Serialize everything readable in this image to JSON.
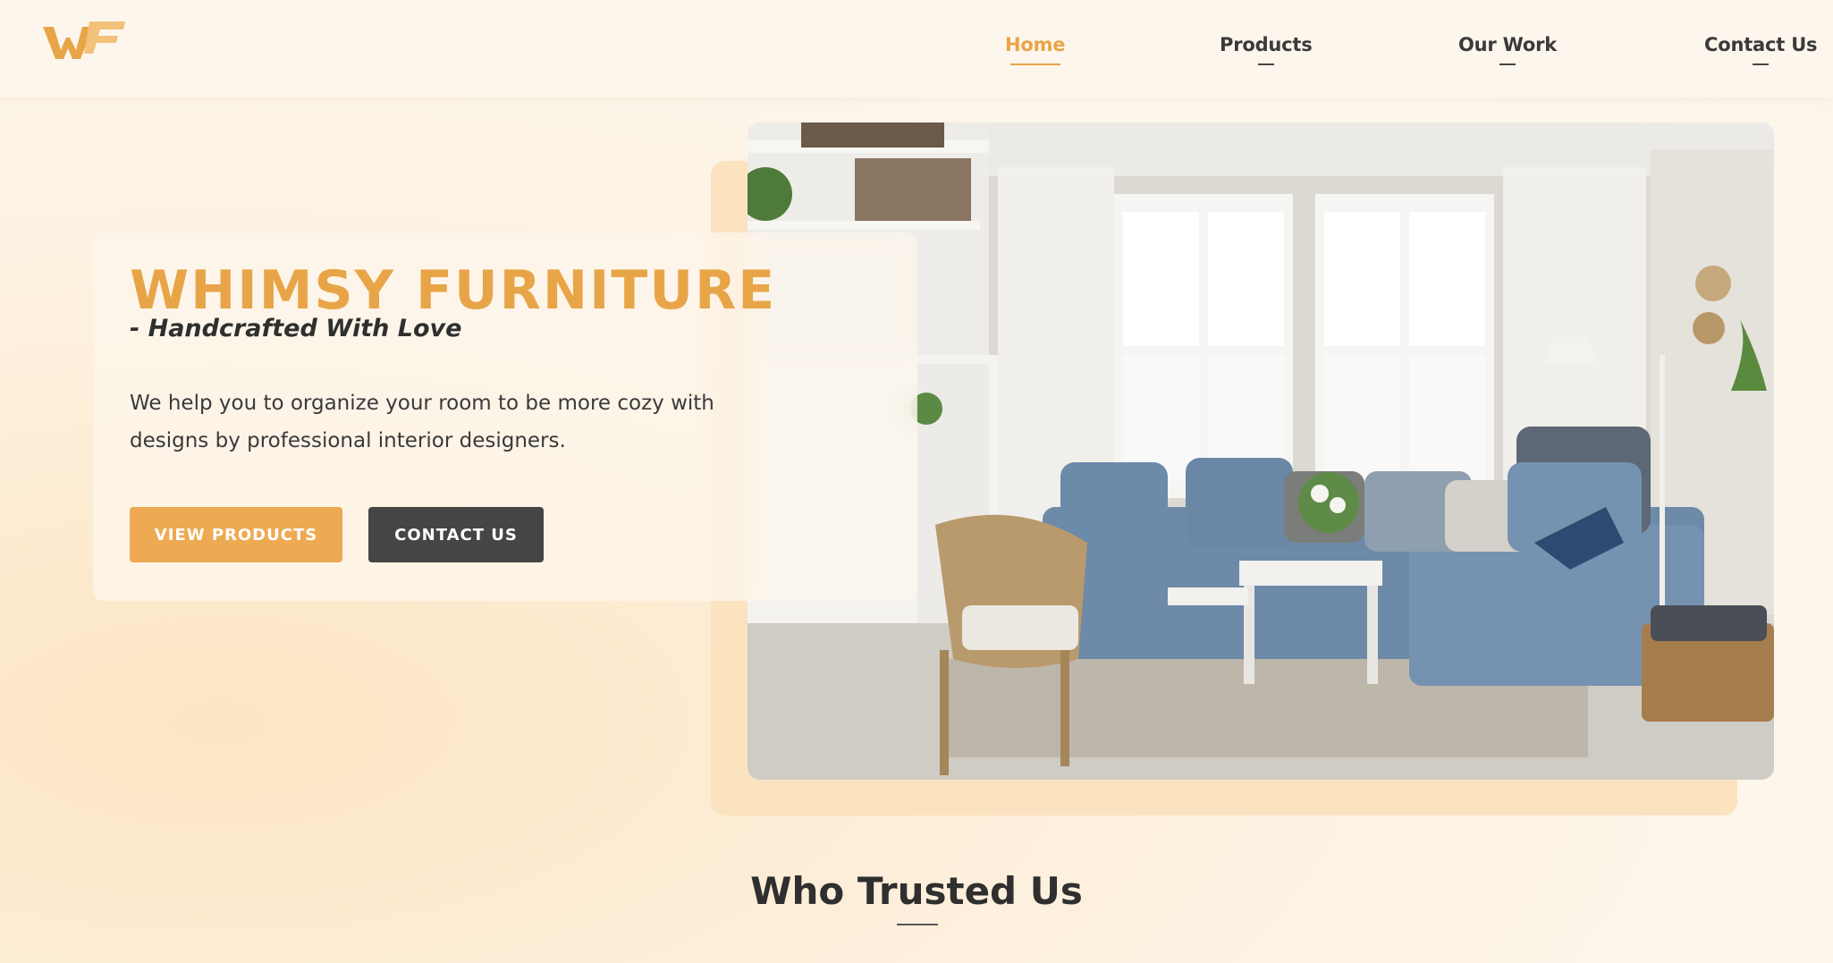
{
  "brand": {
    "logo_text": "WF"
  },
  "nav": {
    "items": [
      {
        "label": "Home",
        "active": true
      },
      {
        "label": "Products",
        "active": false
      },
      {
        "label": "Our Work",
        "active": false
      },
      {
        "label": "Contact Us",
        "active": false
      }
    ]
  },
  "hero": {
    "title": "WHIMSY FURNITURE",
    "subtitle": "- Handcrafted With Love",
    "description": "We help you to organize your room to be more cozy with designs by professional interior designers.",
    "primary_button": "VIEW PRODUCTS",
    "secondary_button": "CONTACT US"
  },
  "section": {
    "title": "Who Trusted Us"
  },
  "colors": {
    "accent": "#e8a548",
    "dark_button": "#454545",
    "background": "#fdf6ec",
    "text": "#2f2f2f"
  }
}
